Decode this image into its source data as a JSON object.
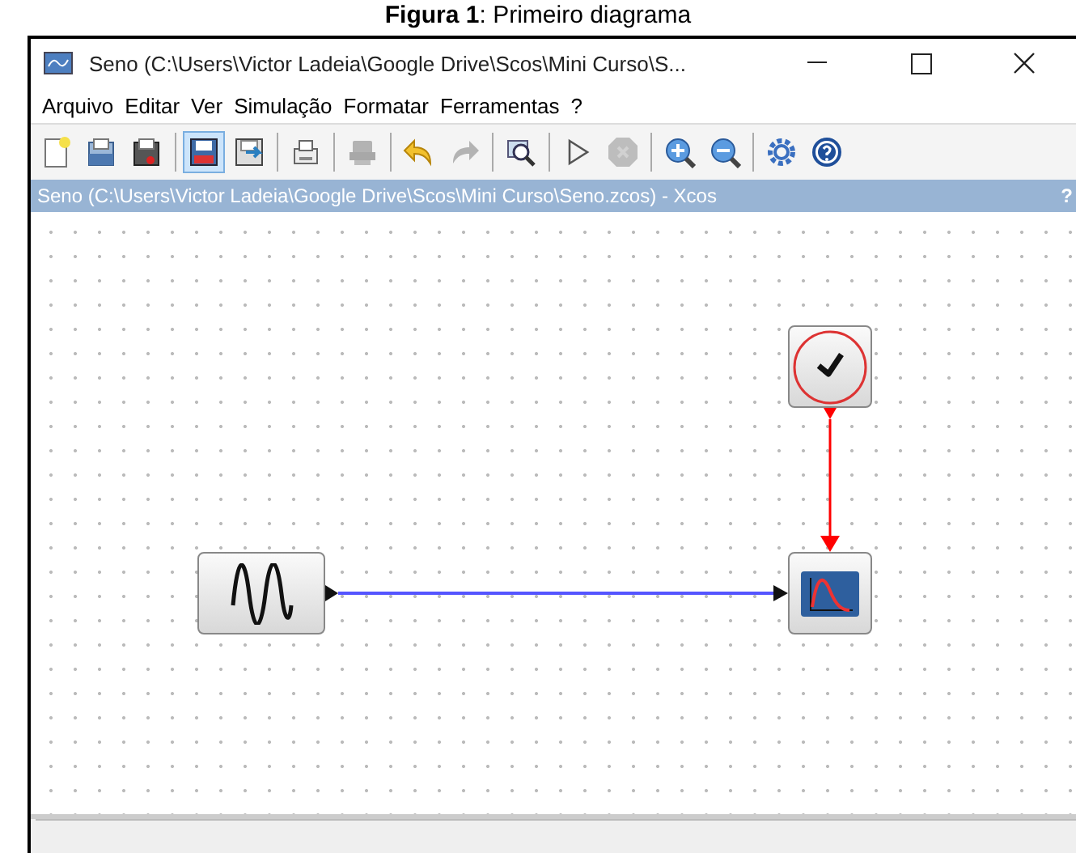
{
  "caption": "**Figura 1**: Primeiro diagrama",
  "window": {
    "title": "Seno (C:\\Users\\Victor Ladeia\\Google Drive\\Scos\\Mini Curso\\S..."
  },
  "menu": [
    "Arquivo",
    "Editar",
    "Ver",
    "Simulação",
    "Formatar",
    "Ferramentas",
    "?"
  ],
  "toolbar": [
    [
      {
        "kind": "new",
        "disabled": false,
        "selected": false
      },
      {
        "kind": "open",
        "disabled": false,
        "selected": false
      },
      {
        "kind": "open-file",
        "disabled": false,
        "selected": false
      }
    ],
    [
      {
        "kind": "save",
        "disabled": false,
        "selected": true
      },
      {
        "kind": "save-as",
        "disabled": false,
        "selected": false
      }
    ],
    [
      {
        "kind": "print",
        "disabled": false,
        "selected": false
      }
    ],
    [
      {
        "kind": "stamp",
        "disabled": true,
        "selected": false
      }
    ],
    [
      {
        "kind": "undo",
        "disabled": false,
        "selected": false
      },
      {
        "kind": "redo",
        "disabled": true,
        "selected": false
      }
    ],
    [
      {
        "kind": "fit",
        "disabled": false,
        "selected": false
      }
    ],
    [
      {
        "kind": "play",
        "disabled": false,
        "selected": false
      },
      {
        "kind": "stop",
        "disabled": true,
        "selected": false
      }
    ],
    [
      {
        "kind": "zoom-in",
        "disabled": false,
        "selected": false
      },
      {
        "kind": "zoom-out",
        "disabled": false,
        "selected": false
      }
    ],
    [
      {
        "kind": "settings",
        "disabled": false,
        "selected": false
      },
      {
        "kind": "help",
        "disabled": false,
        "selected": false
      }
    ]
  ],
  "document_bar": {
    "title": "Seno (C:\\Users\\Victor Ladeia\\Google Drive\\Scos\\Mini Curso\\Seno.zcos) - Xcos",
    "help": "?"
  },
  "diagram": {
    "blocks": [
      {
        "kind": "sine"
      },
      {
        "kind": "clock"
      },
      {
        "kind": "scope"
      }
    ],
    "links": [
      {
        "kind": "regular"
      },
      {
        "kind": "activation"
      }
    ]
  }
}
